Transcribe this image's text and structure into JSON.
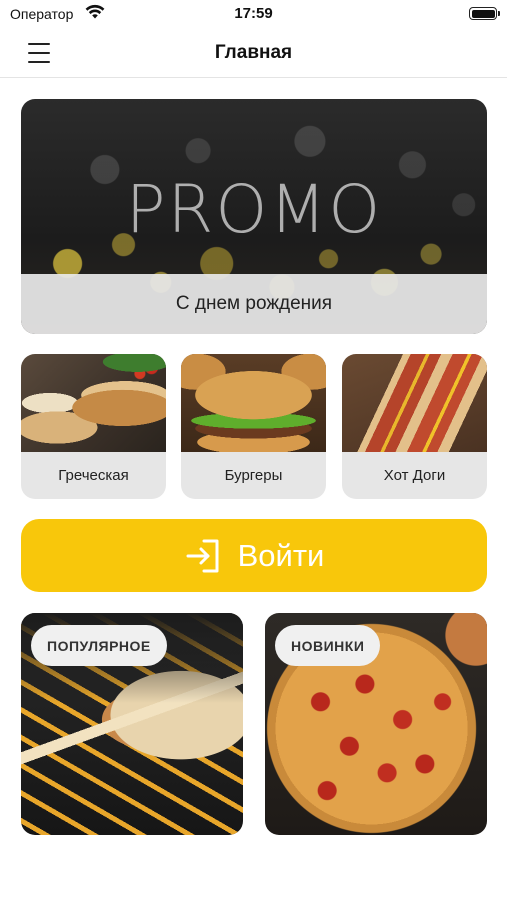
{
  "status_bar": {
    "carrier": "Оператор",
    "time": "17:59"
  },
  "nav": {
    "title": "Главная",
    "menu_icon": "hamburger-menu-icon"
  },
  "promo": {
    "word": "PROMO",
    "caption": "С днем рождения"
  },
  "categories": [
    {
      "label": "Греческая",
      "image": "shawarma-plate"
    },
    {
      "label": "Бургеры",
      "image": "burger"
    },
    {
      "label": "Хот Доги",
      "image": "hot-dogs"
    }
  ],
  "login_button": {
    "label": "Войти",
    "icon": "sign-in-icon",
    "color": "#f8c70b"
  },
  "tiles": [
    {
      "label": "ПОПУЛЯРНОЕ",
      "image": "shawarma-with-fries"
    },
    {
      "label": "НОВИНКИ",
      "image": "pepperoni-pizza"
    }
  ]
}
